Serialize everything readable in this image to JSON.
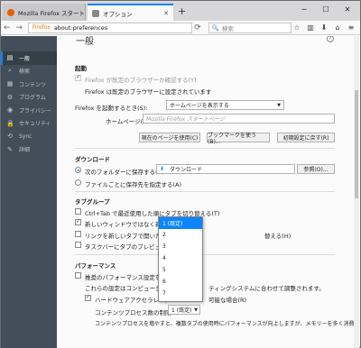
{
  "tabs": [
    {
      "title": "Mozilla Firefox スタートページ",
      "close": "✕"
    },
    {
      "title": "オプション",
      "close": "✕"
    }
  ],
  "new_tab": "+",
  "window_controls": {
    "min": "─",
    "max": "☐",
    "close": "✕"
  },
  "toolbar": {
    "back": "←",
    "forward": "→",
    "url_brand": "Firefox",
    "url": "about:preferences",
    "reload": "⟳",
    "search_icon": "🔍",
    "search_placeholder": "検索"
  },
  "sidebar": {
    "items": [
      {
        "icon": "▤",
        "label": "一般"
      },
      {
        "icon": "⌕",
        "label": "検索"
      },
      {
        "icon": "▦",
        "label": "コンテンツ"
      },
      {
        "icon": "⚙",
        "label": "プログラム"
      },
      {
        "icon": "◉",
        "label": "プライバシー"
      },
      {
        "icon": "🔒",
        "label": "セキュリティ"
      },
      {
        "icon": "⟲",
        "label": "Sync"
      },
      {
        "icon": "✎",
        "label": "詳細"
      }
    ]
  },
  "page": {
    "title": "一般",
    "startup": {
      "heading": "起動",
      "check_default": "Firefox が既定のブラウザーか確認する(Y)",
      "default_status": "Firefox は既定のブラウザーに設定されています",
      "on_start_label": "Firefox を起動するとき(S):",
      "on_start_value": "ホームページを表示する",
      "home_label": "ホームページ(P):",
      "home_placeholder": "Mozilla Firefox スタートページ",
      "btn_current": "現在のページを使用(C)",
      "btn_bookmark": "ブックマークを使う(B)...",
      "btn_restore": "初期設定に戻す(R)"
    },
    "downloads": {
      "heading": "ダウンロード",
      "save_to_label": "次のフォルダーに保存する(V)",
      "folder": "ダウンロード",
      "browse": "参照(O)...",
      "ask_label": "ファイルごとに保存先を指定する(A)"
    },
    "tabs": {
      "heading": "タブグループ",
      "ctrl_tab": "Ctrl+Tab で最近使用した順にタブを切り替える(T)",
      "new_window": "新しいウィンドウではなく新しいタブ",
      "link_tab": "リンクを新しいタブで開いたとき",
      "switch": "替える(H)",
      "taskbar": "タスクバーにタブのプレビューを表示"
    },
    "perf": {
      "heading": "パフォーマンス",
      "recommended": "推奨のパフォーマンス設定を使用",
      "desc": "これらの設定はコンピューターの",
      "desc2": "ティングシステムに合わせて調整されます。",
      "hw": "ハードウェアアクセラレーシ",
      "hw2": "可能な場合(R)",
      "proc_label": "コンテンツプロセス数の制限(L)",
      "proc_value": "1 (既定)",
      "footnote": "コンテンツプロセスを増やすと、複数タブの使用時にパフォーマンスが向上しますが、メモリーを多く消費します。"
    },
    "help_icon": "?"
  },
  "dropdown": {
    "options": [
      "1 (既定)",
      "2",
      "3",
      "4",
      "5",
      "6",
      "7"
    ]
  }
}
